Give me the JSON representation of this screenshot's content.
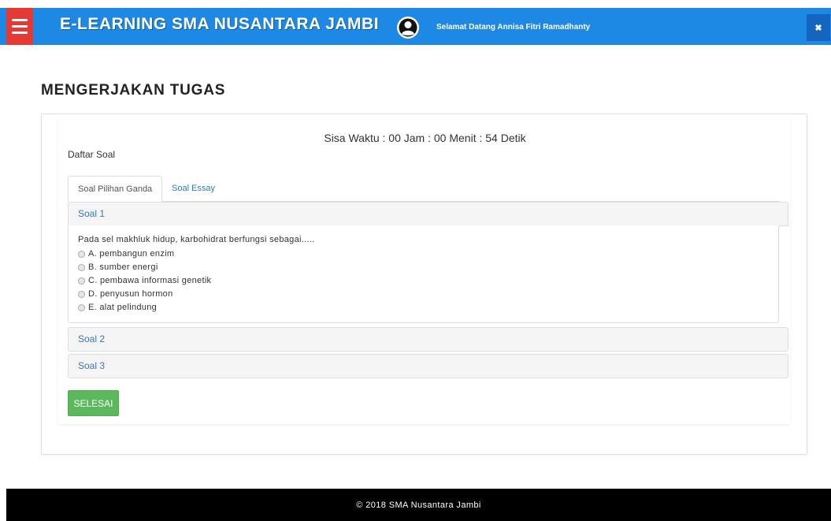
{
  "header": {
    "app_title": "E-LEARNING SMA NUSANTARA JAMBI",
    "welcome_text": "Selamat Datang Annisa Fitri Ramadhanty",
    "menu_icon": "hamburger-menu-icon",
    "avatar_icon": "user-avatar-icon",
    "close_icon": "close-icon",
    "close_glyph": "✖",
    "bar_color": "#1e88e5",
    "menu_color": "#e53935"
  },
  "page": {
    "title": "MENGERJAKAN TUGAS",
    "timer": "Sisa Waktu : 00 Jam : 00 Menit : 54 Detik",
    "list_label": "Daftar Soal"
  },
  "tabs": [
    {
      "label": "Soal Pilihan Ganda",
      "active": true
    },
    {
      "label": "Soal Essay",
      "active": false
    }
  ],
  "questions": [
    {
      "heading": "Soal 1",
      "expanded": true,
      "text": "Pada sel makhluk hidup, karbohidrat berfungsi sebagai.....",
      "options": [
        "A. pembangun enzim",
        "B. sumber energi",
        "C. pembawa informasi genetik",
        "D. penyusun hormon",
        "E. alat pelindung"
      ]
    },
    {
      "heading": "Soal 2",
      "expanded": false
    },
    {
      "heading": "Soal 3",
      "expanded": false
    }
  ],
  "actions": {
    "finish_label": "SELESAI",
    "finish_color": "#5cb85c"
  },
  "footer": {
    "text": "© 2018 SMA Nusantara Jambi"
  }
}
